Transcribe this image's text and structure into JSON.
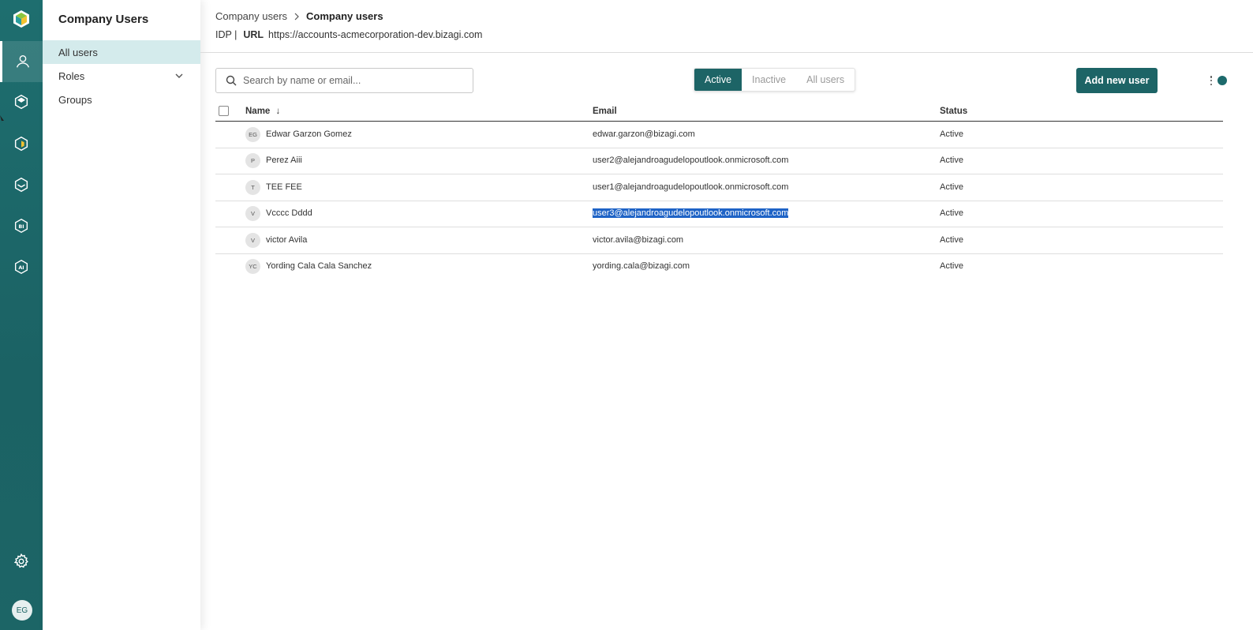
{
  "rail": {
    "items": [
      "users-icon",
      "process-cube-icon",
      "modeler-icon",
      "automation-icon",
      "bi-icon",
      "ai-icon"
    ],
    "settings_icon": "gear-icon",
    "avatar_initials": "EG"
  },
  "sidebar": {
    "title": "Company Users",
    "items": [
      {
        "label": "All users",
        "selected": true
      },
      {
        "label": "Roles",
        "expandable": true
      },
      {
        "label": "Groups"
      }
    ]
  },
  "header": {
    "breadcrumb": [
      "Company users",
      "Company users"
    ],
    "idp_label": "IDP |",
    "url_label": "URL",
    "url_value": "https://accounts-acmecorporation-dev.bizagi.com"
  },
  "toolbar": {
    "search_placeholder": "Search by name or email...",
    "filters": [
      "Active",
      "Inactive",
      "All users"
    ],
    "active_filter": "Active",
    "add_button": "Add new user"
  },
  "table": {
    "columns": [
      "Name",
      "Email",
      "Status"
    ],
    "sort_indicator": "↓",
    "rows": [
      {
        "initials": "EG",
        "name": "Edwar Garzon Gomez",
        "email": "edwar.garzon@bizagi.com",
        "status": "Active"
      },
      {
        "initials": "P",
        "name": "Perez Aiii",
        "email": "user2@alejandroagudelopoutlook.onmicrosoft.com",
        "status": "Active"
      },
      {
        "initials": "T",
        "name": "TEE FEE",
        "email": "user1@alejandroagudelopoutlook.onmicrosoft.com",
        "status": "Active"
      },
      {
        "initials": "V",
        "name": "Vcccc Dddd",
        "email": "user3@alejandroagudelopoutlook.onmicrosoft.com",
        "status": "Active",
        "email_selected": true
      },
      {
        "initials": "V",
        "name": "victor Avila",
        "email": "victor.avila@bizagi.com",
        "status": "Active"
      },
      {
        "initials": "YC",
        "name": "Yording Cala Cala Sanchez",
        "email": "yording.cala@bizagi.com",
        "status": "Active"
      }
    ]
  },
  "colors": {
    "brand": "#1d6466",
    "selection": "#1e63c6",
    "sidebar_selected": "#d4ebec"
  }
}
